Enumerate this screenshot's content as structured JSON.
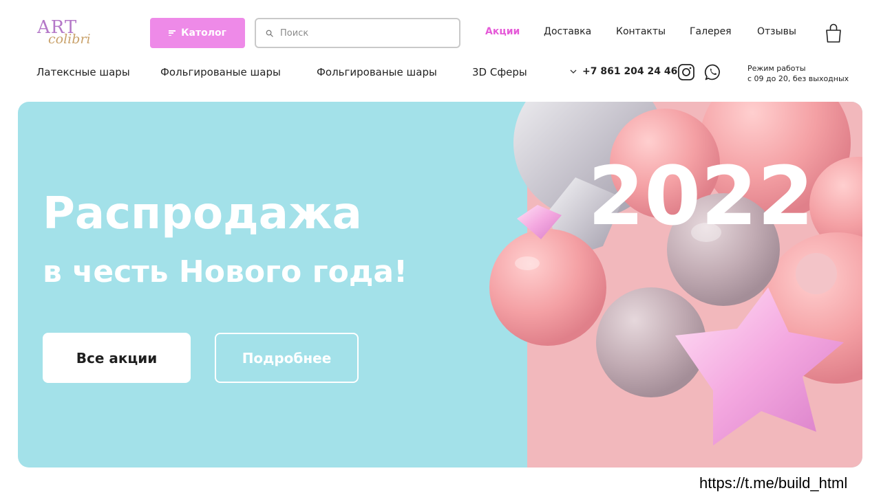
{
  "logo": {
    "line1": "ART",
    "line2": "colibri"
  },
  "header": {
    "catalog_label": "Католог",
    "search_placeholder": "Поиск",
    "nav": [
      "Акции",
      "Доставка",
      "Контакты",
      "Галерея",
      "Отзывы"
    ],
    "active_nav": "Акции"
  },
  "subnav": [
    "Латексные шары",
    "Фольгированые шары",
    "Фольгированые шары",
    "3D Сферы"
  ],
  "contact": {
    "phone": "+7 861 204 24 46",
    "hours_title": "Режим работы",
    "hours_from": "с 09 до 20,",
    "hours_note": "без выходных"
  },
  "hero": {
    "title": "Распродажа",
    "subtitle": "в честь Нового года!",
    "year": "2022",
    "btn_primary": "Все акции",
    "btn_secondary": "Подробнее"
  },
  "footer": {
    "link": "https://t.me/build_html"
  },
  "colors": {
    "accent": "#ee8ae8",
    "active": "#e55ad8",
    "hero_bg": "#a3e1e9"
  },
  "icons": [
    "filter-icon",
    "search-icon",
    "cart-icon",
    "chevron-down-icon",
    "instagram-icon",
    "whatsapp-icon"
  ]
}
